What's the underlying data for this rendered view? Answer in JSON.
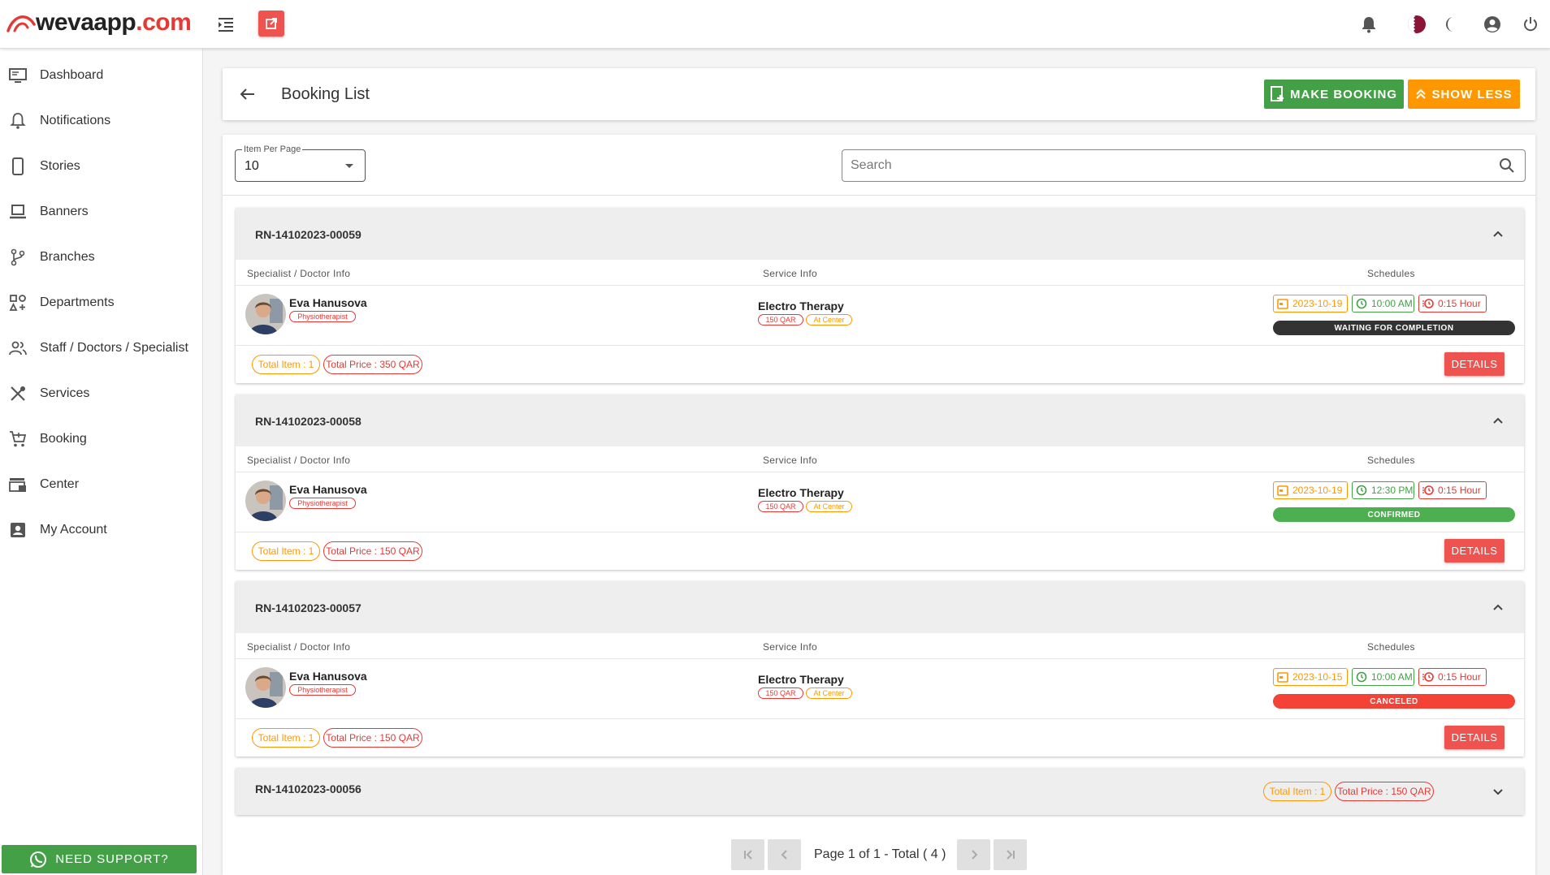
{
  "brand": {
    "name": "wevaapp",
    "domain": ".com"
  },
  "sidebar": {
    "items": [
      {
        "label": "Dashboard",
        "icon": "monitor-icon"
      },
      {
        "label": "Notifications",
        "icon": "bell-outline-icon"
      },
      {
        "label": "Stories",
        "icon": "phone-icon"
      },
      {
        "label": "Banners",
        "icon": "laptop-icon"
      },
      {
        "label": "Branches",
        "icon": "branch-icon"
      },
      {
        "label": "Departments",
        "icon": "category-icon"
      },
      {
        "label": "Staff / Doctors / Specialist",
        "icon": "people-icon"
      },
      {
        "label": "Services",
        "icon": "tools-icon"
      },
      {
        "label": "Booking",
        "icon": "cart-icon"
      },
      {
        "label": "Center",
        "icon": "store-icon"
      },
      {
        "label": "My Account",
        "icon": "account-box-icon"
      }
    ],
    "support_label": "NEED SUPPORT?"
  },
  "header": {
    "title": "Booking List",
    "make_booking": "MAKE BOOKING",
    "show_less": "SHOW LESS"
  },
  "filters": {
    "per_page_label": "Item Per Page",
    "per_page_value": "10",
    "search_placeholder": "Search"
  },
  "columns": {
    "doctor": "Specialist / Doctor Info",
    "service": "Service Info",
    "schedules": "Schedules"
  },
  "bookings": [
    {
      "ref": "RN-14102023-00059",
      "doctor": "Eva Hanusova",
      "role": "Physiotherapist",
      "service": "Electro Therapy",
      "price": "150 QAR",
      "location": "At Center",
      "date": "2023-10-19",
      "time": "10:00 AM",
      "duration": "0:15 Hour",
      "status": "WAITING FOR COMPLETION",
      "status_color": "#333333",
      "total_item": "Total Item : 1",
      "total_price": "Total Price : 350 QAR",
      "details": "DETAILS"
    },
    {
      "ref": "RN-14102023-00058",
      "doctor": "Eva Hanusova",
      "role": "Physiotherapist",
      "service": "Electro Therapy",
      "price": "150 QAR",
      "location": "At Center",
      "date": "2023-10-19",
      "time": "12:30 PM",
      "duration": "0:15 Hour",
      "status": "CONFIRMED",
      "status_color": "#4caf50",
      "total_item": "Total Item : 1",
      "total_price": "Total Price : 150 QAR",
      "details": "DETAILS"
    },
    {
      "ref": "RN-14102023-00057",
      "doctor": "Eva Hanusova",
      "role": "Physiotherapist",
      "service": "Electro Therapy",
      "price": "150 QAR",
      "location": "At Center",
      "date": "2023-10-15",
      "time": "10:00 AM",
      "duration": "0:15 Hour",
      "status": "CANCELED",
      "status_color": "#f44336",
      "total_item": "Total Item : 1",
      "total_price": "Total Price : 150 QAR",
      "details": "DETAILS"
    },
    {
      "ref": "RN-14102023-00056",
      "total_item": "Total Item : 1",
      "total_price": "Total Price : 150 QAR"
    }
  ],
  "pagination": {
    "text": "Page 1 of 1 - Total ( 4 )"
  },
  "colors": {
    "accent_red": "#ef5350",
    "green": "#43a047",
    "orange": "#ff9800"
  }
}
